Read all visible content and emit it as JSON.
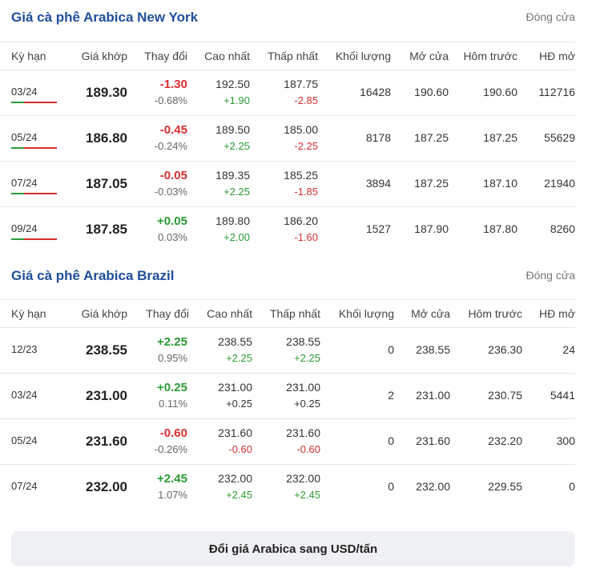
{
  "sections": [
    {
      "title": "Giá cà phê Arabica New York",
      "status": "Đóng cửa",
      "headers": [
        "Kỳ hạn",
        "Giá khớp",
        "Thay đổi",
        "Cao nhất",
        "Thấp nhất",
        "Khối lượng",
        "Mở cửa",
        "Hôm trước",
        "HĐ mở"
      ],
      "rows": [
        {
          "term": "03/24",
          "price": "189.30",
          "change": "-1.30",
          "change_pct": "-0.68%",
          "change_dir": "neg",
          "high": "192.50",
          "high_chg": "+1.90",
          "high_dir": "pos",
          "low": "187.75",
          "low_chg": "-2.85",
          "low_dir": "neg",
          "volume": "16428",
          "open": "190.60",
          "prev": "190.60",
          "oi": "112716"
        },
        {
          "term": "05/24",
          "price": "186.80",
          "change": "-0.45",
          "change_pct": "-0.24%",
          "change_dir": "neg",
          "high": "189.50",
          "high_chg": "+2.25",
          "high_dir": "pos",
          "low": "185.00",
          "low_chg": "-2.25",
          "low_dir": "neg",
          "volume": "8178",
          "open": "187.25",
          "prev": "187.25",
          "oi": "55629"
        },
        {
          "term": "07/24",
          "price": "187.05",
          "change": "-0.05",
          "change_pct": "-0.03%",
          "change_dir": "neg",
          "high": "189.35",
          "high_chg": "+2.25",
          "high_dir": "pos",
          "low": "185.25",
          "low_chg": "-1.85",
          "low_dir": "neg",
          "volume": "3894",
          "open": "187.25",
          "prev": "187.10",
          "oi": "21940"
        },
        {
          "term": "09/24",
          "price": "187.85",
          "change": "+0.05",
          "change_pct": "0.03%",
          "change_dir": "pos",
          "high": "189.80",
          "high_chg": "+2.00",
          "high_dir": "pos",
          "low": "186.20",
          "low_chg": "-1.60",
          "low_dir": "neg",
          "volume": "1527",
          "open": "187.90",
          "prev": "187.80",
          "oi": "8260"
        }
      ]
    },
    {
      "title": "Giá cà phê Arabica Brazil",
      "status": "Đóng cửa",
      "headers": [
        "Kỳ hạn",
        "Giá khớp",
        "Thay đổi",
        "Cao nhất",
        "Thấp nhất",
        "Khối lượng",
        "Mở cửa",
        "Hôm trước",
        "HĐ mở"
      ],
      "rows": [
        {
          "term": "12/23",
          "price": "238.55",
          "change": "+2.25",
          "change_pct": "0.95%",
          "change_dir": "pos",
          "high": "238.55",
          "high_chg": "+2.25",
          "high_dir": "pos",
          "low": "238.55",
          "low_chg": "+2.25",
          "low_dir": "pos",
          "volume": "0",
          "open": "238.55",
          "prev": "236.30",
          "oi": "24"
        },
        {
          "term": "03/24",
          "price": "231.00",
          "change": "+0.25",
          "change_pct": "0.11%",
          "change_dir": "pos",
          "high": "231.00",
          "high_chg": "+0.25",
          "high_dir": "zero",
          "low": "231.00",
          "low_chg": "+0.25",
          "low_dir": "zero",
          "volume": "2",
          "open": "231.00",
          "prev": "230.75",
          "oi": "5441"
        },
        {
          "term": "05/24",
          "price": "231.60",
          "change": "-0.60",
          "change_pct": "-0.26%",
          "change_dir": "neg",
          "high": "231.60",
          "high_chg": "-0.60",
          "high_dir": "neg",
          "low": "231.60",
          "low_chg": "-0.60",
          "low_dir": "neg",
          "volume": "0",
          "open": "231.60",
          "prev": "232.20",
          "oi": "300"
        },
        {
          "term": "07/24",
          "price": "232.00",
          "change": "+2.45",
          "change_pct": "1.07%",
          "change_dir": "pos",
          "high": "232.00",
          "high_chg": "+2.45",
          "high_dir": "pos",
          "low": "232.00",
          "low_chg": "+2.45",
          "low_dir": "pos",
          "volume": "0",
          "open": "232.00",
          "prev": "229.55",
          "oi": "0"
        }
      ]
    }
  ],
  "convert_button": "Đổi giá Arabica sang USD/tấn",
  "colors": {
    "title": "#1f4e9c",
    "up": "#2a9a33",
    "down": "#d62f2f"
  }
}
